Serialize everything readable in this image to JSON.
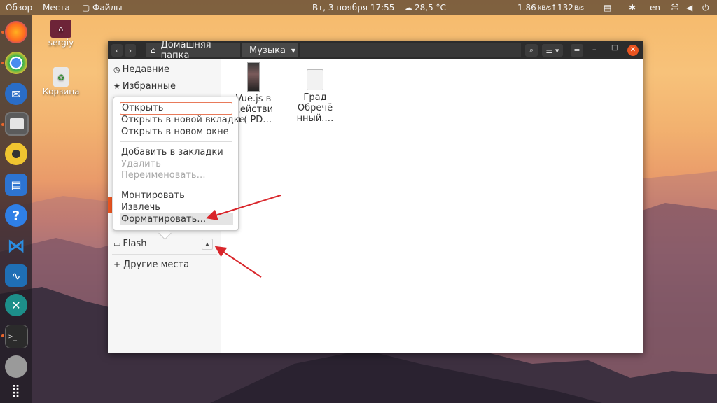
{
  "topbar": {
    "overview": "Обзор",
    "places": "Места",
    "files": "Файлы",
    "datetime": "Вт, 3 ноября  17:55",
    "weather": "28,5 °C",
    "net_down": "1.86",
    "net_down_unit": "kB/s",
    "net_up": "132",
    "net_up_unit": "B/s",
    "lang": "en"
  },
  "desktop": {
    "home_label": "sergiy",
    "trash_label": "Корзина"
  },
  "window": {
    "breadcrumb_home": "Домашняя папка",
    "breadcrumb_current": "Музыка"
  },
  "sidebar": {
    "recent": "Недавние",
    "starred": "Избранные",
    "flash": "Flash",
    "other": "Другие места"
  },
  "files": [
    {
      "name_line1": "Vue.js в",
      "name_line2": "действи",
      "name_line3": "и ( PD…"
    },
    {
      "name_line1": "Град",
      "name_line2": "Обречё",
      "name_line3": "нный.…"
    }
  ],
  "menu": {
    "open": "Открыть",
    "open_tab": "Открыть в новой вкладке",
    "open_window": "Открыть в новом окне",
    "bookmark": "Добавить в закладки",
    "delete": "Удалить",
    "rename": "Переименовать…",
    "mount": "Монтировать",
    "eject": "Извлечь",
    "format": "Форматировать…"
  },
  "colors": {
    "accent": "#e95420",
    "arrow": "#d9262b"
  }
}
